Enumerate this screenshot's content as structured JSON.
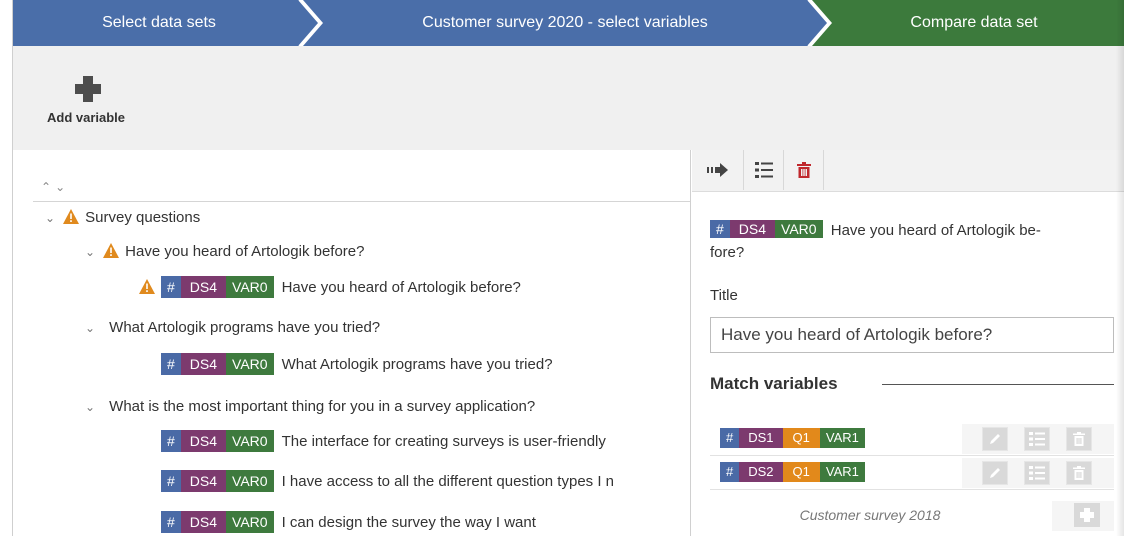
{
  "steps": [
    {
      "label": "Select data sets",
      "color": "#4a6ea9"
    },
    {
      "label": "Customer survey 2020 - select variables",
      "color": "#4a6ea9"
    },
    {
      "label": "Compare data set",
      "color": "#3c7a3c"
    }
  ],
  "toolbar": {
    "add_variable": "Add variable",
    "icon": "plus-icon"
  },
  "tree": {
    "root": "Survey questions",
    "q1": {
      "label": "Have you heard of Artologik before?",
      "var": {
        "hash": "#",
        "ds": "DS4",
        "var": "VAR0",
        "text": "Have you heard of Artologik before?"
      }
    },
    "q2": {
      "label": "What Artologik programs have you tried?",
      "var": {
        "hash": "#",
        "ds": "DS4",
        "var": "VAR0",
        "text": "What Artologik programs have you tried?"
      }
    },
    "q3": {
      "label": "What is the most important thing for you in a survey application?",
      "vars": [
        {
          "hash": "#",
          "ds": "DS4",
          "var": "VAR0",
          "text": "The interface for creating surveys is user-friendly"
        },
        {
          "hash": "#",
          "ds": "DS4",
          "var": "VAR0",
          "text": "I have access to all the different question types I n"
        },
        {
          "hash": "#",
          "ds": "DS4",
          "var": "VAR0",
          "text": "I can design the survey the way I want"
        }
      ]
    }
  },
  "detail": {
    "header": {
      "hash": "#",
      "ds": "DS4",
      "var": "VAR0",
      "text_line1": "Have you heard of Artologik be-",
      "text_line2": "fore?"
    },
    "title_label": "Title",
    "title_value": "Have you heard of Artologik before?",
    "match_heading": "Match variables",
    "matches": [
      {
        "hash": "#",
        "ds": "DS1",
        "q": "Q1",
        "var": "VAR1"
      },
      {
        "hash": "#",
        "ds": "DS2",
        "q": "Q1",
        "var": "VAR1"
      }
    ],
    "footer_source": "Customer survey 2018"
  },
  "colors": {
    "hash": "#4a6aa6",
    "ds": "#7c3a6e",
    "var": "#3e7a3e",
    "q": "#e2891b",
    "warning": "#e08a1e",
    "delete": "#c0282d"
  }
}
